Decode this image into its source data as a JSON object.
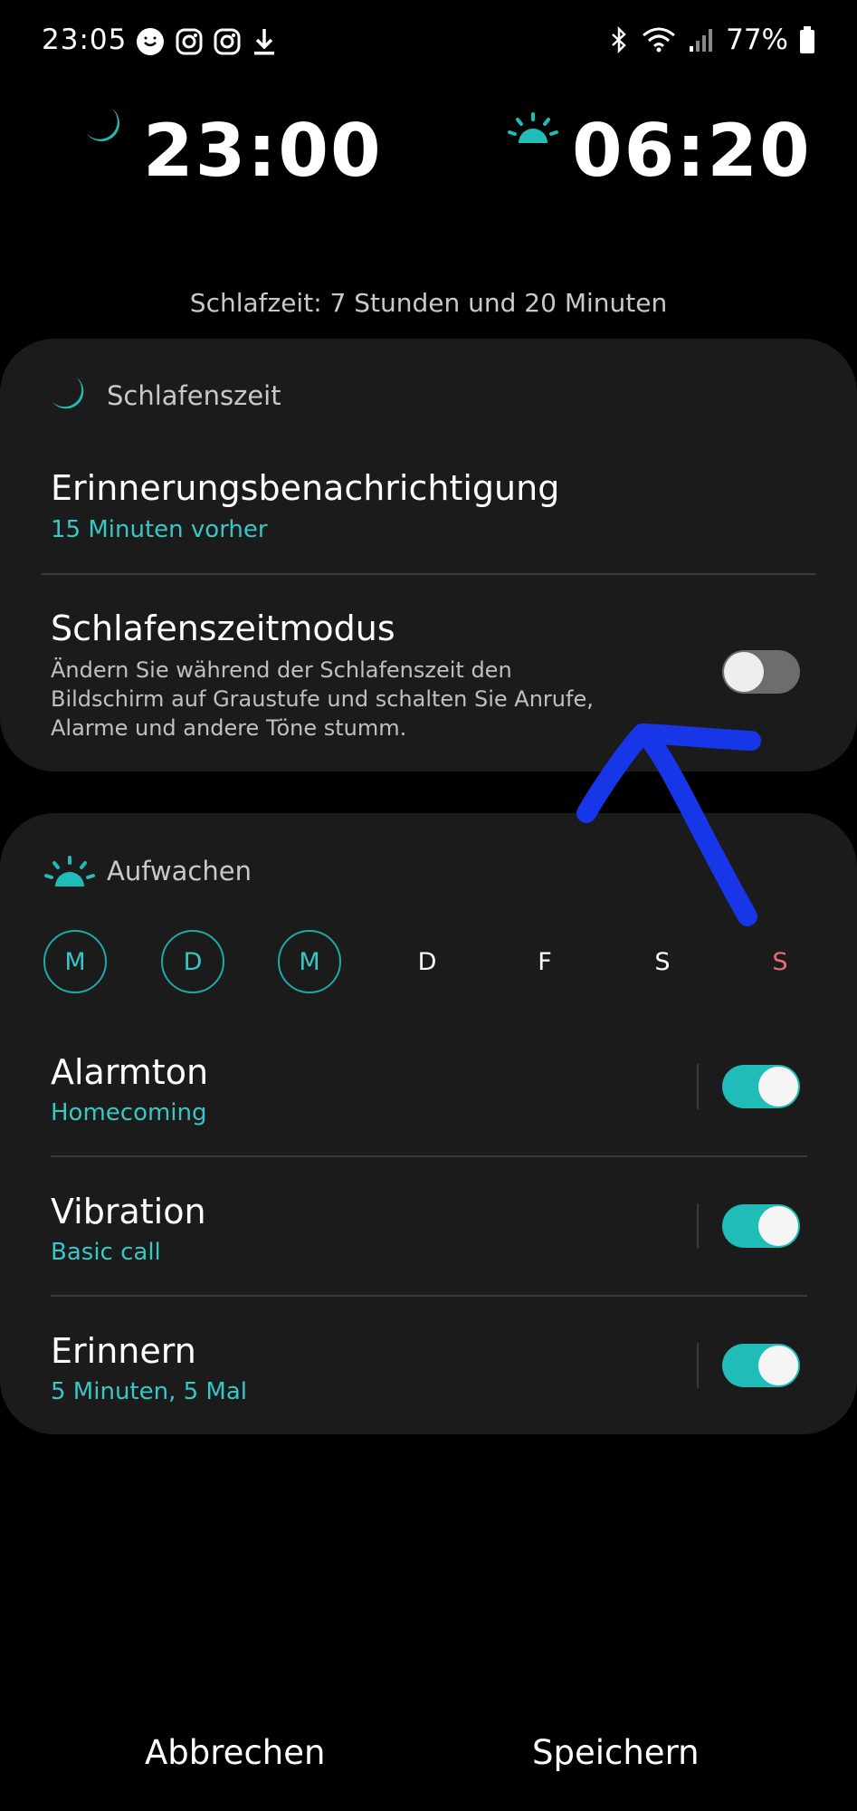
{
  "status_bar": {
    "time": "23:05",
    "battery": "77%",
    "left_icons": [
      "smiley-icon",
      "instagram-icon",
      "instagram-icon",
      "download-icon"
    ],
    "right_icons": [
      "bluetooth-icon",
      "wifi-icon",
      "signal-icon",
      "battery-icon"
    ]
  },
  "bedtime_time": "23:00",
  "wake_time": "06:20",
  "sleep_duration": "Schlafzeit: 7 Stunden und 20 Minuten",
  "bedtime_section": {
    "title": "Schlafenszeit",
    "reminder": {
      "title": "Erinnerungsbenachrichtigung",
      "value": "15 Minuten vorher"
    },
    "mode": {
      "title": "Schlafenszeitmodus",
      "desc_line1": "Ändern Sie während der Schlafenszeit den",
      "desc_line2": "Bildschirm auf Graustufe und schalten Sie Anrufe,",
      "desc_line3": "Alarme und andere Töne stumm.",
      "enabled": false
    }
  },
  "wake_section": {
    "title": "Aufwachen",
    "days": [
      {
        "label": "M",
        "selected": true
      },
      {
        "label": "D",
        "selected": true
      },
      {
        "label": "M",
        "selected": true
      },
      {
        "label": "D",
        "selected": false
      },
      {
        "label": "F",
        "selected": false
      },
      {
        "label": "S",
        "selected": false
      },
      {
        "label": "S",
        "selected": false
      }
    ],
    "alarm_tone": {
      "title": "Alarmton",
      "value": "Homecoming",
      "enabled": true
    },
    "vibration": {
      "title": "Vibration",
      "value": "Basic call",
      "enabled": true
    },
    "snooze": {
      "title": "Erinnern",
      "value": "5 Minuten, 5 Mal",
      "enabled": true
    }
  },
  "buttons": {
    "cancel": "Abbrechen",
    "save": "Speichern"
  },
  "colors": {
    "accent": "#39c6c6",
    "toggle_on": "#20bcb8",
    "sunday": "#e56e79",
    "annotation": "#1736e8"
  }
}
